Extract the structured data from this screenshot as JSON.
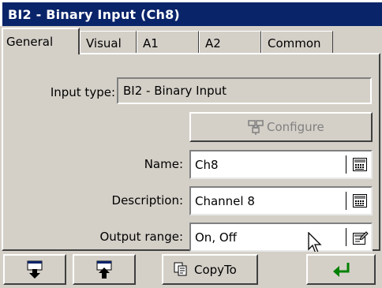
{
  "window": {
    "title": "BI2 - Binary Input (Ch8)"
  },
  "tabs": [
    {
      "label": "General"
    },
    {
      "label": "Visual"
    },
    {
      "label": "A1"
    },
    {
      "label": "A2"
    },
    {
      "label": "Common"
    }
  ],
  "form": {
    "input_type": {
      "label": "Input type:",
      "value": "BI2 - Binary Input"
    },
    "configure_label": "Configure",
    "name": {
      "label": "Name:",
      "value": "Ch8",
      "icon": "keyboard-icon"
    },
    "description": {
      "label": "Description:",
      "value": "Channel 8",
      "icon": "keyboard-icon"
    },
    "output_range": {
      "label": "Output range:",
      "value": "On, Off",
      "icon": "edit-list-icon"
    }
  },
  "toolbar": {
    "save_icon": "save-down-icon",
    "load_icon": "load-up-icon",
    "copyto_label": "CopyTo",
    "ok_icon": "enter-arrow-icon",
    "ok_color": "#008000"
  }
}
